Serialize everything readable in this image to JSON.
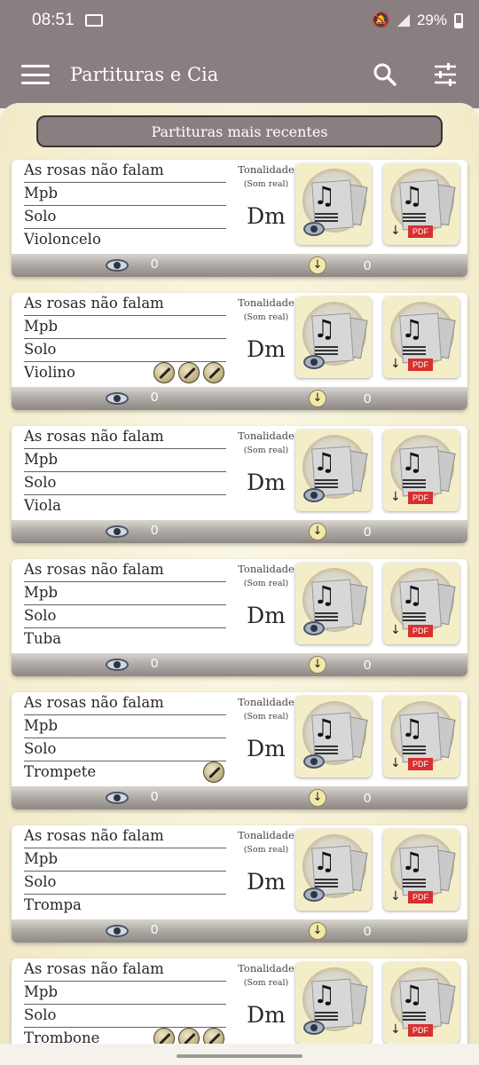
{
  "status_bar": {
    "time": "08:51",
    "battery": "29%"
  },
  "app_bar": {
    "title": "Partituras e Cia",
    "menu_icon": "hamburger-menu-icon",
    "search_icon": "search-icon",
    "filter_icon": "filter-sliders-icon"
  },
  "section_header": "Partituras mais recentes",
  "card_labels": {
    "tonality": "Tonalidade",
    "concert_pitch": "(Som real)",
    "pdf_badge": "PDF"
  },
  "cards": [
    {
      "title": "As rosas não falam",
      "genre": "Mpb",
      "type": "Solo",
      "instrument": "Violoncelo",
      "key": "Dm",
      "views": "0",
      "downloads": "0",
      "instrument_icon_count": 0
    },
    {
      "title": "As rosas não falam",
      "genre": "Mpb",
      "type": "Solo",
      "instrument": "Violino",
      "key": "Dm",
      "views": "0",
      "downloads": "0",
      "instrument_icon_count": 3
    },
    {
      "title": "As rosas não falam",
      "genre": "Mpb",
      "type": "Solo",
      "instrument": "Viola",
      "key": "Dm",
      "views": "0",
      "downloads": "0",
      "instrument_icon_count": 0
    },
    {
      "title": "As rosas não falam",
      "genre": "Mpb",
      "type": "Solo",
      "instrument": "Tuba",
      "key": "Dm",
      "views": "0",
      "downloads": "0",
      "instrument_icon_count": 0
    },
    {
      "title": "As rosas não falam",
      "genre": "Mpb",
      "type": "Solo",
      "instrument": "Trompete",
      "key": "Dm",
      "views": "0",
      "downloads": "0",
      "instrument_icon_count": 1
    },
    {
      "title": "As rosas não falam",
      "genre": "Mpb",
      "type": "Solo",
      "instrument": "Trompa",
      "key": "Dm",
      "views": "0",
      "downloads": "0",
      "instrument_icon_count": 0
    },
    {
      "title": "As rosas não falam",
      "genre": "Mpb",
      "type": "Solo",
      "instrument": "Trombone",
      "key": "Dm",
      "views": "",
      "downloads": "",
      "instrument_icon_count": 3
    }
  ]
}
